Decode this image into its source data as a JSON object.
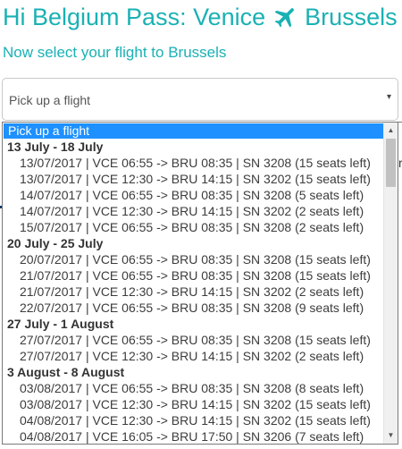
{
  "header": {
    "title_before": "Hi Belgium Pass: Venice",
    "title_after": "Brussels",
    "plane_icon": "airplane-icon",
    "subtitle": "Now select your flight to Brussels"
  },
  "select": {
    "value": "Pick up a flight",
    "caret": "▾"
  },
  "dropdown": {
    "placeholder": "Pick up a flight",
    "selected_bg": "#1e90ff",
    "groups": [
      {
        "label": "13 July - 18 July",
        "flights": [
          "13/07/2017 | VCE 06:55 -> BRU 08:35 | SN 3208 (15 seats left)",
          "13/07/2017 | VCE 12:30 -> BRU 14:15 | SN 3202 (15 seats left)",
          "14/07/2017 | VCE 06:55 -> BRU 08:35 | SN 3208 (5 seats left)",
          "14/07/2017 | VCE 12:30 -> BRU 14:15 | SN 3202 (2 seats left)",
          "15/07/2017 | VCE 06:55 -> BRU 08:35 | SN 3208 (2 seats left)"
        ]
      },
      {
        "label": "20 July - 25 July",
        "flights": [
          "20/07/2017 | VCE 06:55 -> BRU 08:35 | SN 3208 (15 seats left)",
          "21/07/2017 | VCE 06:55 -> BRU 08:35 | SN 3208 (15 seats left)",
          "21/07/2017 | VCE 12:30 -> BRU 14:15 | SN 3202 (2 seats left)",
          "22/07/2017 | VCE 06:55 -> BRU 08:35 | SN 3208 (9 seats left)"
        ]
      },
      {
        "label": "27 July - 1 August",
        "flights": [
          "27/07/2017 | VCE 06:55 -> BRU 08:35 | SN 3208 (15 seats left)",
          "27/07/2017 | VCE 12:30 -> BRU 14:15 | SN 3202 (2 seats left)"
        ]
      },
      {
        "label": "3 August - 8 August",
        "flights": [
          "03/08/2017 | VCE 06:55 -> BRU 08:35 | SN 3208 (8 seats left)",
          "03/08/2017 | VCE 12:30 -> BRU 14:15 | SN 3202 (15 seats left)",
          "04/08/2017 | VCE 12:30 -> BRU 14:15 | SN 3202 (15 seats left)",
          "04/08/2017 | VCE 16:05 -> BRU 17:50 | SN 3206 (7 seats left)"
        ]
      }
    ]
  },
  "scrollbar": {
    "up_arrow": "▲",
    "down_arrow": "▼"
  },
  "background_peek": {
    "mark": "r"
  },
  "colors": {
    "accent": "#1ab1b4",
    "text": "#3c3c3c"
  }
}
